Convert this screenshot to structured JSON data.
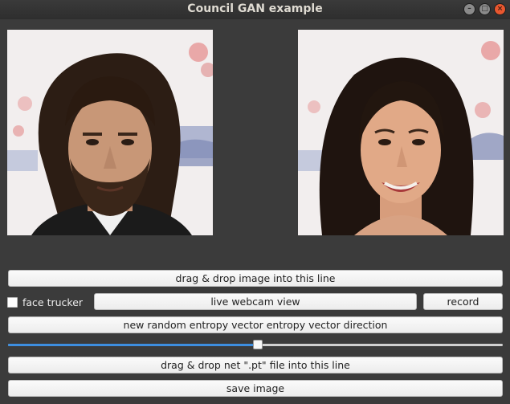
{
  "window": {
    "title": "Council GAN example",
    "minimize_icon": "minimize-icon",
    "maximize_icon": "maximize-icon",
    "close_icon": "close-icon"
  },
  "images": {
    "input_description": "photo-face-man",
    "output_description": "photo-face-woman"
  },
  "controls": {
    "drop_image_label": "drag & drop image into this line",
    "face_trucker_label": "face trucker",
    "face_trucker_checked": false,
    "webcam_label": "live webcam view",
    "record_label": "record",
    "random_vector_label": "new random entropy vector  entropy vector direction",
    "slider_value": 0.505,
    "drop_net_label": "drag & drop net \".pt\" file into this line",
    "save_label": "save image"
  },
  "colors": {
    "accent": "#3d8ee0",
    "close_button": "#e9572f",
    "window_bg": "#3b3b3b"
  }
}
